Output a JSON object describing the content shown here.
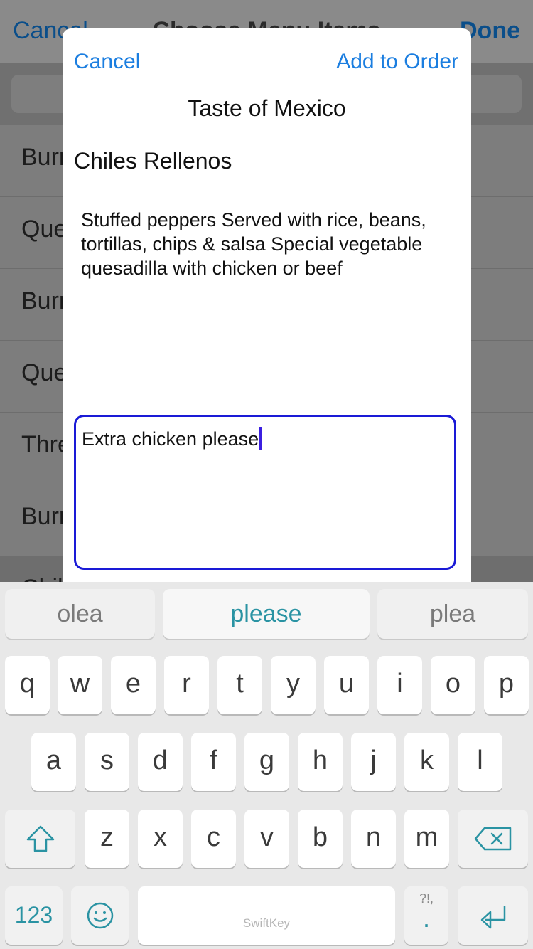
{
  "background": {
    "nav": {
      "left": "Cancel",
      "title": "Choose Menu Items",
      "right": "Done"
    },
    "list_items": [
      "Burr",
      "Que",
      "Burr",
      "Que",
      "Thre",
      "Burr",
      "Chil"
    ]
  },
  "modal": {
    "cancel_label": "Cancel",
    "add_label": "Add to Order",
    "restaurant": "Taste of Mexico",
    "item_name": "Chiles Rellenos",
    "description": "Stuffed peppers Served with rice, beans, tortillas, chips & salsa Special vegetable quesadilla with chicken or beef",
    "notes_value": "Extra chicken please"
  },
  "keyboard": {
    "predictions": [
      "olea",
      "please",
      "plea"
    ],
    "row1": [
      "q",
      "w",
      "e",
      "r",
      "t",
      "y",
      "u",
      "i",
      "o",
      "p"
    ],
    "row2": [
      "a",
      "s",
      "d",
      "f",
      "g",
      "h",
      "j",
      "k",
      "l"
    ],
    "row3": [
      "z",
      "x",
      "c",
      "v",
      "b",
      "n",
      "m"
    ],
    "numbers_label": "123",
    "space_brand": "SwiftKey",
    "punct_top": "?!,",
    "punct_main": ".",
    "icons": [
      "shift-icon",
      "backspace-icon",
      "emoji-icon",
      "return-icon"
    ],
    "accent_color": "#2a93a3"
  }
}
